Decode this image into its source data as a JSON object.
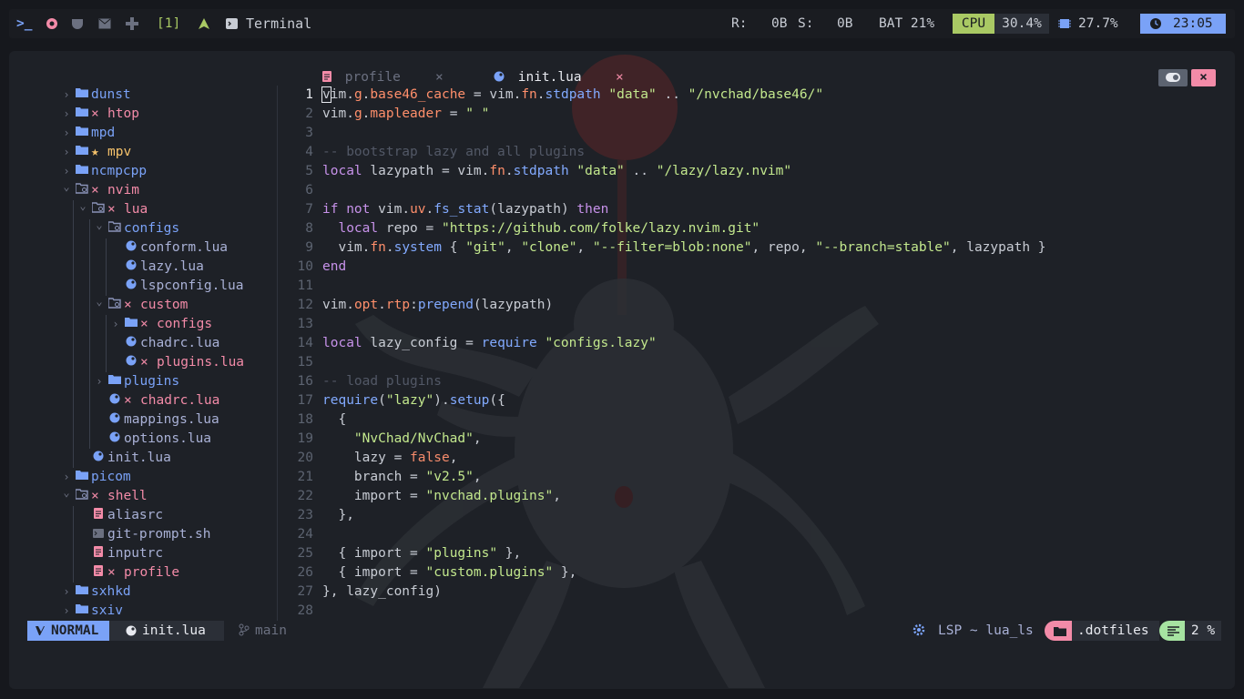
{
  "topbar": {
    "workspace": "[1]",
    "window_title": "Terminal",
    "r_label": "R:",
    "r_value": "0B",
    "s_label": "S:",
    "s_value": "0B",
    "bat": "BAT 21%",
    "cpu_label": "CPU",
    "cpu_value": "30.4%",
    "mem_value": "27.7%",
    "clock": "23:05",
    "colors": {
      "cpu_bg": "#a9c964",
      "clock_bg": "#7aa2f7"
    }
  },
  "tabs": [
    {
      "label": "profile",
      "active": false
    },
    {
      "label": "init.lua",
      "active": true
    }
  ],
  "tree": [
    {
      "label": "dunst",
      "type": "dir",
      "open": false,
      "depth": 0
    },
    {
      "label": "htop",
      "type": "dir",
      "open": false,
      "depth": 0,
      "mark": "×"
    },
    {
      "label": "mpd",
      "type": "dir",
      "open": false,
      "depth": 0
    },
    {
      "label": "mpv",
      "type": "dir",
      "open": false,
      "depth": 0,
      "mark": "★"
    },
    {
      "label": "ncmpcpp",
      "type": "dir",
      "open": false,
      "depth": 0
    },
    {
      "label": "nvim",
      "type": "dir",
      "open": true,
      "depth": 0,
      "mark": "×"
    },
    {
      "label": "lua",
      "type": "dir",
      "open": true,
      "depth": 1,
      "mark": "×"
    },
    {
      "label": "configs",
      "type": "dir",
      "open": true,
      "depth": 2
    },
    {
      "label": "conform.lua",
      "type": "lua",
      "depth": 3
    },
    {
      "label": "lazy.lua",
      "type": "lua",
      "depth": 3
    },
    {
      "label": "lspconfig.lua",
      "type": "lua",
      "depth": 3
    },
    {
      "label": "custom",
      "type": "dir",
      "open": true,
      "depth": 2,
      "mark": "×"
    },
    {
      "label": "configs",
      "type": "dir",
      "open": false,
      "depth": 3,
      "mark": "×"
    },
    {
      "label": "chadrc.lua",
      "type": "lua",
      "depth": 3
    },
    {
      "label": "plugins.lua",
      "type": "lua",
      "depth": 3,
      "mark": "×"
    },
    {
      "label": "plugins",
      "type": "dir",
      "open": false,
      "depth": 2
    },
    {
      "label": "chadrc.lua",
      "type": "lua",
      "depth": 2,
      "mark": "×"
    },
    {
      "label": "mappings.lua",
      "type": "lua",
      "depth": 2
    },
    {
      "label": "options.lua",
      "type": "lua",
      "depth": 2
    },
    {
      "label": "init.lua",
      "type": "lua",
      "depth": 1
    },
    {
      "label": "picom",
      "type": "dir",
      "open": false,
      "depth": 0
    },
    {
      "label": "shell",
      "type": "dir",
      "open": true,
      "depth": 0,
      "mark": "×"
    },
    {
      "label": "aliasrc",
      "type": "text",
      "depth": 1
    },
    {
      "label": "git-prompt.sh",
      "type": "sh",
      "depth": 1
    },
    {
      "label": "inputrc",
      "type": "text",
      "depth": 1
    },
    {
      "label": "profile",
      "type": "text",
      "depth": 1,
      "mark": "×"
    },
    {
      "label": "sxhkd",
      "type": "dir",
      "open": false,
      "depth": 0
    },
    {
      "label": "sxiv",
      "type": "dir",
      "open": false,
      "depth": 0
    }
  ],
  "code": [
    [
      [
        "vim",
        "vr"
      ],
      [
        ".",
        "vr"
      ],
      [
        "g",
        "fld"
      ],
      [
        ".",
        "vr"
      ],
      [
        "base46_cache",
        "fld"
      ],
      [
        " = ",
        "vr"
      ],
      [
        "vim",
        "vr"
      ],
      [
        ".",
        "vr"
      ],
      [
        "fn",
        "fld"
      ],
      [
        ".",
        "vr"
      ],
      [
        "stdpath",
        "fn"
      ],
      [
        " ",
        "vr"
      ],
      [
        "\"data\"",
        "str"
      ],
      [
        " .. ",
        "vr"
      ],
      [
        "\"/nvchad/base46/\"",
        "str"
      ]
    ],
    [
      [
        "vim",
        "vr"
      ],
      [
        ".",
        "vr"
      ],
      [
        "g",
        "fld"
      ],
      [
        ".",
        "vr"
      ],
      [
        "mapleader",
        "fld"
      ],
      [
        " = ",
        "vr"
      ],
      [
        "\" \"",
        "str"
      ]
    ],
    [],
    [
      [
        "-- bootstrap lazy and all plugins",
        "cm"
      ]
    ],
    [
      [
        "local",
        "kw"
      ],
      [
        " lazypath = ",
        "vr"
      ],
      [
        "vim",
        "vr"
      ],
      [
        ".",
        "vr"
      ],
      [
        "fn",
        "fld"
      ],
      [
        ".",
        "vr"
      ],
      [
        "stdpath",
        "fn"
      ],
      [
        " ",
        "vr"
      ],
      [
        "\"data\"",
        "str"
      ],
      [
        " .. ",
        "vr"
      ],
      [
        "\"/lazy/lazy.nvim\"",
        "str"
      ]
    ],
    [],
    [
      [
        "if",
        "kw"
      ],
      [
        " ",
        "vr"
      ],
      [
        "not",
        "kw"
      ],
      [
        " vim",
        "vr"
      ],
      [
        ".",
        "vr"
      ],
      [
        "uv",
        "fld"
      ],
      [
        ".",
        "vr"
      ],
      [
        "fs_stat",
        "fn"
      ],
      [
        "(",
        "vr"
      ],
      [
        "lazypath",
        "vr"
      ],
      [
        ")",
        "vr"
      ],
      [
        " ",
        "vr"
      ],
      [
        "then",
        "kw"
      ]
    ],
    [
      [
        "  ",
        "vr"
      ],
      [
        "local",
        "kw"
      ],
      [
        " repo = ",
        "vr"
      ],
      [
        "\"https://github.com/folke/lazy.nvim.git\"",
        "str"
      ]
    ],
    [
      [
        "  vim",
        "vr"
      ],
      [
        ".",
        "vr"
      ],
      [
        "fn",
        "fld"
      ],
      [
        ".",
        "vr"
      ],
      [
        "system",
        "fn"
      ],
      [
        " { ",
        "vr"
      ],
      [
        "\"git\"",
        "str"
      ],
      [
        ", ",
        "vr"
      ],
      [
        "\"clone\"",
        "str"
      ],
      [
        ", ",
        "vr"
      ],
      [
        "\"--filter=blob:none\"",
        "str"
      ],
      [
        ", repo, ",
        "vr"
      ],
      [
        "\"--branch=stable\"",
        "str"
      ],
      [
        ", lazypath }",
        "vr"
      ]
    ],
    [
      [
        "end",
        "kw"
      ]
    ],
    [],
    [
      [
        "vim",
        "vr"
      ],
      [
        ".",
        "vr"
      ],
      [
        "opt",
        "fld"
      ],
      [
        ".",
        "vr"
      ],
      [
        "rtp",
        "fld"
      ],
      [
        ":",
        "vr"
      ],
      [
        "prepend",
        "fn"
      ],
      [
        "(lazypath)",
        "vr"
      ]
    ],
    [],
    [
      [
        "local",
        "kw"
      ],
      [
        " lazy_config = ",
        "vr"
      ],
      [
        "require",
        "fn"
      ],
      [
        " ",
        "vr"
      ],
      [
        "\"configs.lazy\"",
        "str"
      ]
    ],
    [],
    [
      [
        "-- load plugins",
        "cm"
      ]
    ],
    [
      [
        "require",
        "fn"
      ],
      [
        "(",
        "vr"
      ],
      [
        "\"lazy\"",
        "str"
      ],
      [
        ")",
        "vr"
      ],
      [
        ".",
        "vr"
      ],
      [
        "setup",
        "fn"
      ],
      [
        "({",
        "vr"
      ]
    ],
    [
      [
        "  {",
        "vr"
      ]
    ],
    [
      [
        "    ",
        "vr"
      ],
      [
        "\"NvChad/NvChad\"",
        "str"
      ],
      [
        ",",
        "vr"
      ]
    ],
    [
      [
        "    lazy = ",
        "vr"
      ],
      [
        "false",
        "bool"
      ],
      [
        ",",
        "vr"
      ]
    ],
    [
      [
        "    branch = ",
        "vr"
      ],
      [
        "\"v2.5\"",
        "str"
      ],
      [
        ",",
        "vr"
      ]
    ],
    [
      [
        "    import = ",
        "vr"
      ],
      [
        "\"nvchad.plugins\"",
        "str"
      ],
      [
        ",",
        "vr"
      ]
    ],
    [
      [
        "  },",
        "vr"
      ]
    ],
    [],
    [
      [
        "  { import = ",
        "vr"
      ],
      [
        "\"plugins\"",
        "str"
      ],
      [
        " },",
        "vr"
      ]
    ],
    [
      [
        "  { import = ",
        "vr"
      ],
      [
        "\"custom.plugins\"",
        "str"
      ],
      [
        " },",
        "vr"
      ]
    ],
    [
      [
        "}, lazy_config)",
        "vr"
      ]
    ],
    []
  ],
  "status": {
    "mode": "NORMAL",
    "file": "init.lua",
    "branch": "main",
    "lsp": "LSP ~ lua_ls",
    "cwd": ".dotfiles",
    "progress": "2 %",
    "colors": {
      "mode_bg": "#7aa2f7",
      "cwd_bg": "#f38ba8",
      "progress_bg": "#a6e3a1"
    }
  }
}
